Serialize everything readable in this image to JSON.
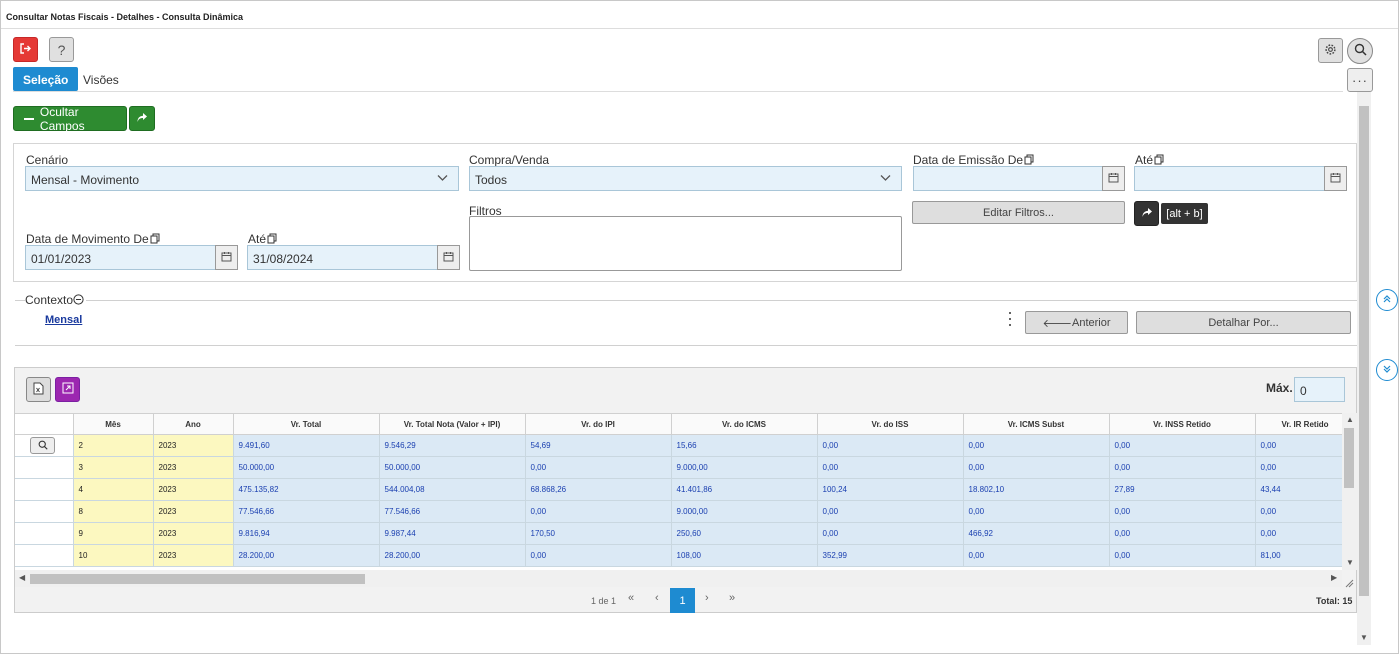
{
  "window": {
    "title": "Consultar Notas Fiscais - Detalhes - Consulta Dinâmica"
  },
  "toolbar": {
    "exit_icon": "exit-icon",
    "help_label": "?",
    "settings_icon": "gear-icon",
    "search_icon": "search-icon",
    "more_label": "···"
  },
  "tabs": [
    {
      "label": "Seleção",
      "active": true
    },
    {
      "label": "Visões",
      "active": false
    }
  ],
  "actions": {
    "hide_fields_label": "Ocultar Campos",
    "share_icon": "share-icon"
  },
  "form": {
    "cenario": {
      "label": "Cenário",
      "value": "Mensal - Movimento"
    },
    "compra_venda": {
      "label": "Compra/Venda",
      "value": "Todos"
    },
    "data_emissao_de": {
      "label": "Data de Emissão De",
      "value": ""
    },
    "data_emissao_ate": {
      "label": "Até",
      "value": ""
    },
    "filtros": {
      "label": "Filtros",
      "value": ""
    },
    "editar_filtros": "Editar Filtros...",
    "shortcut_tooltip": "[alt + b]",
    "data_mov_de": {
      "label": "Data de Movimento De",
      "value": "01/01/2023"
    },
    "data_mov_ate": {
      "label": "Até",
      "value": "31/08/2024"
    }
  },
  "context": {
    "legend": "Contexto",
    "link": "Mensal",
    "anterior_label": "Anterior",
    "detalhar_label": "Detalhar Por..."
  },
  "grid": {
    "max_label": "Máx.",
    "max_value": "0",
    "columns": [
      "Mês",
      "Ano",
      "Vr. Total",
      "Vr. Total Nota (Valor + IPI)",
      "Vr. do IPI",
      "Vr. do ICMS",
      "Vr. do ISS",
      "Vr. ICMS Subst",
      "Vr. INSS Retido",
      "Vr. IR Retido"
    ],
    "rows": [
      [
        "2",
        "2023",
        "9.491,60",
        "9.546,29",
        "54,69",
        "15,66",
        "0,00",
        "0,00",
        "0,00",
        "0,00"
      ],
      [
        "3",
        "2023",
        "50.000,00",
        "50.000,00",
        "0,00",
        "9.000,00",
        "0,00",
        "0,00",
        "0,00",
        "0,00"
      ],
      [
        "4",
        "2023",
        "475.135,82",
        "544.004,08",
        "68.868,26",
        "41.401,86",
        "100,24",
        "18.802,10",
        "27,89",
        "43,44"
      ],
      [
        "8",
        "2023",
        "77.546,66",
        "77.546,66",
        "0,00",
        "9.000,00",
        "0,00",
        "0,00",
        "0,00",
        "0,00"
      ],
      [
        "9",
        "2023",
        "9.816,94",
        "9.987,44",
        "170,50",
        "250,60",
        "0,00",
        "466,92",
        "0,00",
        "0,00"
      ],
      [
        "10",
        "2023",
        "28.200,00",
        "28.200,00",
        "0,00",
        "108,00",
        "352,99",
        "0,00",
        "0,00",
        "81,00"
      ]
    ],
    "pager": {
      "page_info": "1 de 1",
      "first": "«",
      "prev": "‹",
      "current": "1",
      "next": "›",
      "last": "»",
      "total_label": "Total: 15"
    }
  }
}
